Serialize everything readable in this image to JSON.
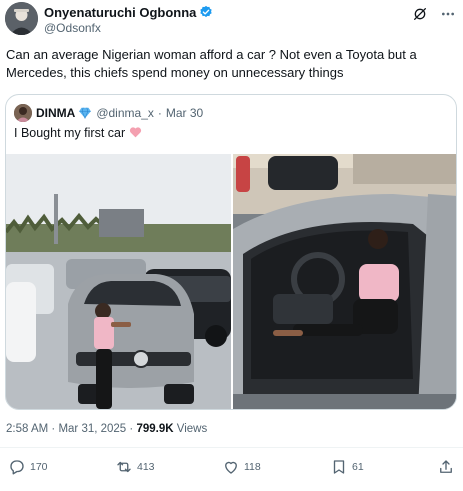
{
  "post": {
    "author_name": "Onyenaturuchi Ogbonna",
    "author_handle": "@Odsonfx",
    "text": "Can an average Nigerian woman afford a car ? Not even a Toyota but a Mercedes, this chiefs spend money on unnecessary things"
  },
  "quote": {
    "name": "DINMA",
    "handle": "@dinma_x",
    "date": "Mar 30",
    "text": "I Bought my first car"
  },
  "meta": {
    "time": "2:58 AM",
    "date": "Mar 31, 2025",
    "views_count": "799.9K",
    "views_label": "Views"
  },
  "actions": {
    "replies": "170",
    "reposts": "413",
    "likes": "118",
    "bookmarks": "61"
  },
  "icons": [
    "verified-badge-icon",
    "grok-icon",
    "more-icon",
    "gem-icon",
    "heart-emoji-icon",
    "reply-icon",
    "repost-icon",
    "like-icon",
    "bookmark-icon",
    "share-icon"
  ],
  "colors": {
    "verified": "#1d9bf0",
    "secondary_text": "#536471",
    "border": "#cfd9de",
    "heart_emoji": "#f4a0b0"
  }
}
